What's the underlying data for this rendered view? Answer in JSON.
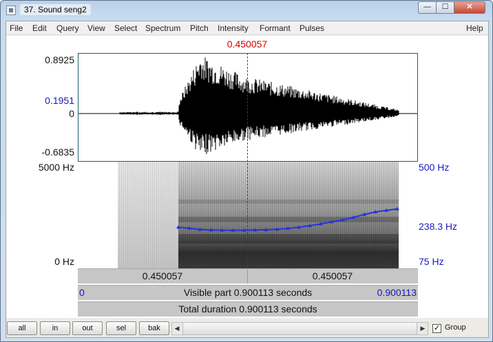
{
  "window": {
    "title": "37. Sound seng2",
    "minimize_glyph": "—",
    "maximize_glyph": "☐",
    "close_glyph": "✕"
  },
  "menu": [
    {
      "label": "File"
    },
    {
      "label": "Edit"
    },
    {
      "label": "Query"
    },
    {
      "label": "View"
    },
    {
      "label": "Select"
    },
    {
      "label": "Spectrum"
    },
    {
      "label": "Pitch"
    },
    {
      "label": "Intensity"
    },
    {
      "label": "Formant"
    },
    {
      "label": "Pulses"
    },
    {
      "label": "Help"
    }
  ],
  "editor": {
    "cursor_time": "0.450057",
    "waveform": {
      "y_max": "0.8925",
      "y_cursor": "0.1951",
      "y_zero": "0",
      "y_min": "-0.6835"
    },
    "spectrogram": {
      "freq_top": "5000 Hz",
      "freq_bottom": "0 Hz"
    },
    "pitch": {
      "top": "500 Hz",
      "cursor_value": "238.3 Hz",
      "bottom": "75 Hz",
      "contour_hz": [
        239,
        235,
        230,
        228,
        227,
        227,
        227,
        228,
        229,
        231,
        234,
        239,
        245,
        252,
        260,
        268,
        278,
        290,
        300,
        306,
        312
      ]
    },
    "selection_bar": {
      "left": "0.450057",
      "right": "0.450057"
    },
    "visible_bar": {
      "start": "0",
      "text": "Visible part 0.900113 seconds",
      "end": "0.900113"
    },
    "total_bar": {
      "text": "Total duration 0.900113 seconds"
    }
  },
  "controls": {
    "buttons": [
      "all",
      "in",
      "out",
      "sel",
      "bak"
    ],
    "scroll_left_glyph": "◀",
    "scroll_right_glyph": "▶",
    "group_checked": true,
    "group_label": "Group",
    "check_glyph": "✓"
  },
  "colors": {
    "cursor": "#d40000",
    "axis_blue": "#1818b8",
    "pitch": "#2233dd"
  }
}
